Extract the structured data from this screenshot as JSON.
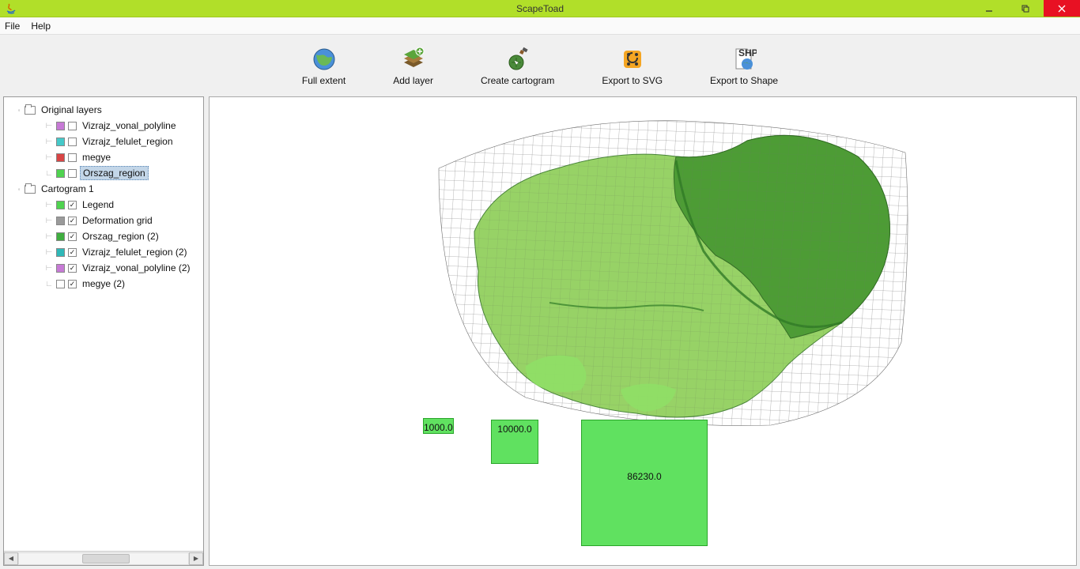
{
  "window": {
    "title": "ScapeToad"
  },
  "menubar": {
    "file": "File",
    "help": "Help"
  },
  "toolbar": {
    "full_extent": "Full extent",
    "add_layer": "Add layer",
    "create_cartogram": "Create cartogram",
    "export_svg": "Export to SVG",
    "export_shape": "Export to Shape"
  },
  "tree": {
    "group1": "Original layers",
    "g1_items": [
      {
        "swatch": "#c77ad6",
        "label": "Vizrajz_vonal_polyline",
        "checked": false,
        "sel": false
      },
      {
        "swatch": "#45c9c9",
        "label": "Vizrajz_felulet_region",
        "checked": false,
        "sel": false
      },
      {
        "swatch": "#d94545",
        "label": "megye",
        "checked": false,
        "sel": false
      },
      {
        "swatch": "#4fd34f",
        "label": "Orszag_region",
        "checked": false,
        "sel": true
      }
    ],
    "group2": "Cartogram 1",
    "g2_items": [
      {
        "swatch": "#4fd34f",
        "label": "Legend",
        "checked": true
      },
      {
        "swatch": "#9a9a9a",
        "label": "Deformation grid",
        "checked": true
      },
      {
        "swatch": "#3fae3f",
        "label": "Orszag_region (2)",
        "checked": true
      },
      {
        "swatch": "#2fb8b8",
        "label": "Vizrajz_felulet_region (2)",
        "checked": true
      },
      {
        "swatch": "#c77ad6",
        "label": "Vizrajz_vonal_polyline (2)",
        "checked": true
      },
      {
        "swatch": "#ffffff",
        "label": "megye (2)",
        "checked": true
      }
    ]
  },
  "legend": {
    "v1": "1000.0",
    "v2": "10000.0",
    "v3": "86230.0"
  },
  "colors": {
    "accent": "#b1df29",
    "close": "#e81123",
    "map_light": "#8fcf5a",
    "map_dark": "#4a9a33",
    "grid": "#707070"
  }
}
